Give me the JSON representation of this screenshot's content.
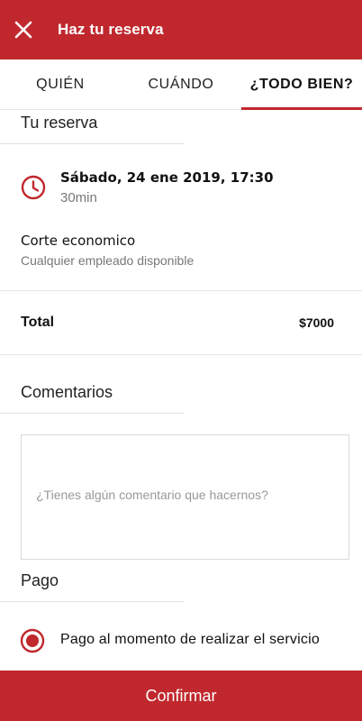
{
  "colors": {
    "accent": "#c0282d",
    "muted_text": "#777777",
    "divider": "#e5e5e5"
  },
  "header": {
    "title": "Haz tu reserva",
    "close_icon": "close-icon"
  },
  "tabs": [
    {
      "label": "QUIÉN",
      "active": false
    },
    {
      "label": "CUÁNDO",
      "active": false
    },
    {
      "label": "¿TODO BIEN?",
      "active": true
    }
  ],
  "reservation": {
    "section_title": "Tu reserva",
    "icon": "clock-icon",
    "datetime": "Sábado, 24 ene 2019, 17:30",
    "duration": "30min",
    "service": "Corte economico",
    "staff": "Cualquier empleado disponible"
  },
  "total": {
    "label": "Total",
    "value": "$7000"
  },
  "comments": {
    "section_title": "Comentarios",
    "placeholder": "¿Tienes algún comentario que hacernos?",
    "value": ""
  },
  "payment": {
    "section_title": "Pago",
    "option_label": "Pago al momento de realizar el servicio",
    "selected": true
  },
  "footer": {
    "confirm_label": "Confirmar"
  }
}
